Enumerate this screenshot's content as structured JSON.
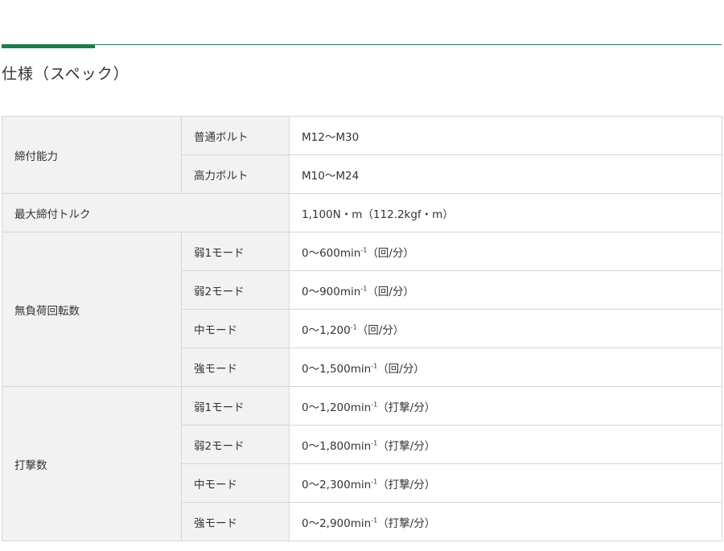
{
  "section": {
    "title": "仕様（スペック）",
    "accent_color": "#1f7a4d"
  },
  "spec": {
    "fastening": {
      "label": "締付能力",
      "rows": [
        {
          "sub": "普通ボルト",
          "value": "M12〜M30"
        },
        {
          "sub": "高力ボルト",
          "value": "M10〜M24"
        }
      ]
    },
    "max_torque": {
      "label": "最大締付トルク",
      "value": "1,100N・m（112.2kgf・m）"
    },
    "no_load_speed": {
      "label": "無負荷回転数",
      "rows": [
        {
          "sub": "弱1モード",
          "value": "0〜600min",
          "exp": "-1",
          "unit": "（回/分）"
        },
        {
          "sub": "弱2モード",
          "value": "0〜900min",
          "exp": "-1",
          "unit": "（回/分）"
        },
        {
          "sub": "中モード",
          "value": "0〜1,200",
          "exp": "-1",
          "unit": "（回/分）"
        },
        {
          "sub": "強モード",
          "value": "0〜1,500min",
          "exp": "-1",
          "unit": "（回/分）"
        }
      ]
    },
    "impact_rate": {
      "label": "打撃数",
      "rows": [
        {
          "sub": "弱1モード",
          "value": "0〜1,200min",
          "exp": "-1",
          "unit": "（打撃/分）"
        },
        {
          "sub": "弱2モード",
          "value": "0〜1,800min",
          "exp": "-1",
          "unit": "（打撃/分）"
        },
        {
          "sub": "中モード",
          "value": "0〜2,300min",
          "exp": "-1",
          "unit": "（打撃/分）"
        },
        {
          "sub": "強モード",
          "value": "0〜2,900min",
          "exp": "-1",
          "unit": "（打撃/分）"
        }
      ]
    }
  }
}
